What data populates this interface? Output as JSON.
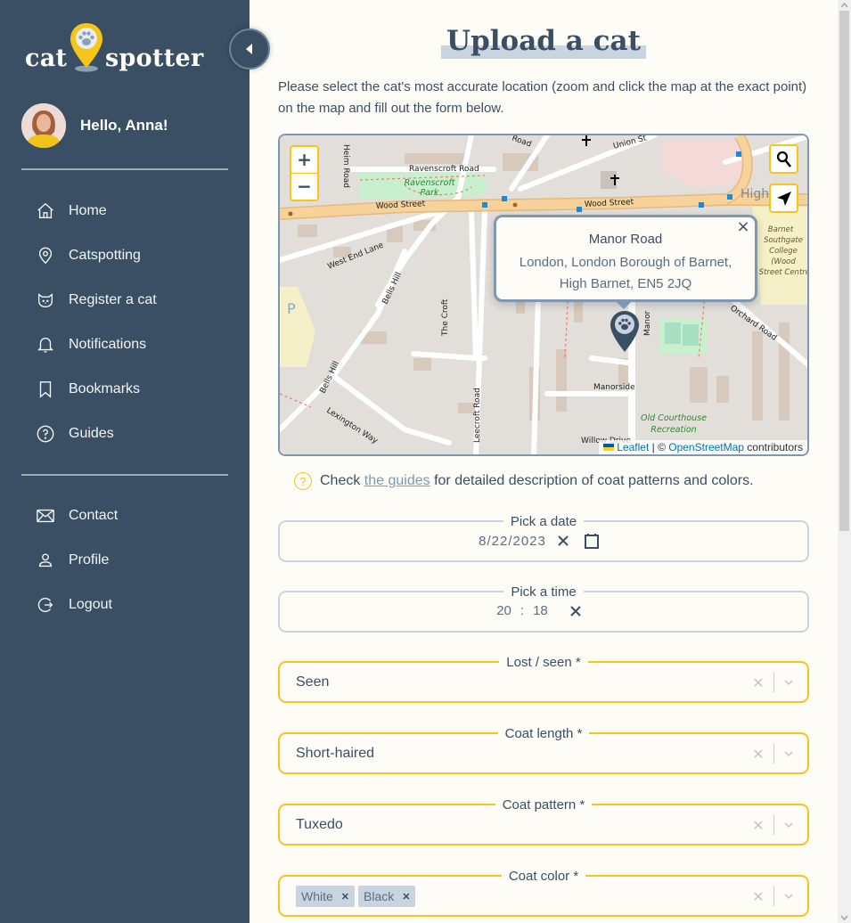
{
  "app": {
    "logo_left": "cat",
    "logo_right": "spotter"
  },
  "user": {
    "greeting": "Hello, Anna!"
  },
  "sidebar": {
    "primary": [
      {
        "label": "Home",
        "icon": "home-icon"
      },
      {
        "label": "Catspotting",
        "icon": "map-pin-icon"
      },
      {
        "label": "Register a cat",
        "icon": "cat-icon"
      },
      {
        "label": "Notifications",
        "icon": "bell-icon"
      },
      {
        "label": "Bookmarks",
        "icon": "bookmark-icon"
      },
      {
        "label": "Guides",
        "icon": "question-circle-icon"
      }
    ],
    "secondary": [
      {
        "label": "Contact",
        "icon": "envelope-icon"
      },
      {
        "label": "Profile",
        "icon": "user-icon"
      },
      {
        "label": "Logout",
        "icon": "logout-icon"
      }
    ]
  },
  "page": {
    "title": "Upload a cat",
    "intro": "Please select the cat's most accurate location (zoom and click the map at the exact point) on the map and fill out the form below."
  },
  "map": {
    "zoom_in": "+",
    "zoom_out": "−",
    "popup": {
      "title": "Manor Road",
      "address_line1": "London, London Borough of Barnet,",
      "address_line2": "High Barnet, EN5 2JQ",
      "close": "×"
    },
    "labels": {
      "ravenscroft_road": "Ravenscroft Road",
      "ravenscroft_park_1": "Ravenscroft",
      "ravenscroft_park_2": "Park",
      "wood_street_1": "Wood Street",
      "wood_street_2": "Wood Street",
      "west_end_lane": "West End Lane",
      "bells_hill_1": "Bells Hill",
      "bells_hill_2": "Bells Hill",
      "lexington_way": "Lexington Way",
      "the_croft": "The Croft",
      "leecroft_road": "Leecroft Road",
      "manorside": "Manorside",
      "manor": "Manor",
      "orchard_road": "Orchard Road",
      "old_courthouse_1": "Old Courthouse",
      "old_courthouse_2": "Recreation",
      "college_1": "Barnet",
      "college_2": "Southgate",
      "college_3": "College",
      "college_4": "(Wood",
      "college_5": "Street Centre)",
      "high": "High",
      "union": "Union St",
      "willow": "Willow Drive",
      "road_top": "Road",
      "heim_road": "Heim Road"
    },
    "attribution": {
      "leaflet": "Leaflet",
      "separator": " | © ",
      "osm": "OpenStreetMap",
      "suffix": " contributors"
    }
  },
  "hint": {
    "prefix": "Check ",
    "link": "the guides",
    "suffix": " for detailed description of coat patterns and colors."
  },
  "form": {
    "date": {
      "label": "Pick a date",
      "value": "8/22/2023"
    },
    "time": {
      "label": "Pick a time",
      "hours": "20",
      "separator": ":",
      "minutes": "18"
    },
    "lost_seen": {
      "label": "Lost / seen *",
      "value": "Seen"
    },
    "coat_length": {
      "label": "Coat length *",
      "value": "Short-haired"
    },
    "coat_pattern": {
      "label": "Coat pattern *",
      "value": "Tuxedo"
    },
    "coat_color": {
      "label": "Coat color *",
      "values": [
        "White",
        "Black"
      ]
    }
  },
  "colors": {
    "sidebar_bg": "#3a4f63",
    "accent_yellow": "#f5c518",
    "page_bg": "#fdfcf7",
    "border_blue": "#7d98b3"
  }
}
